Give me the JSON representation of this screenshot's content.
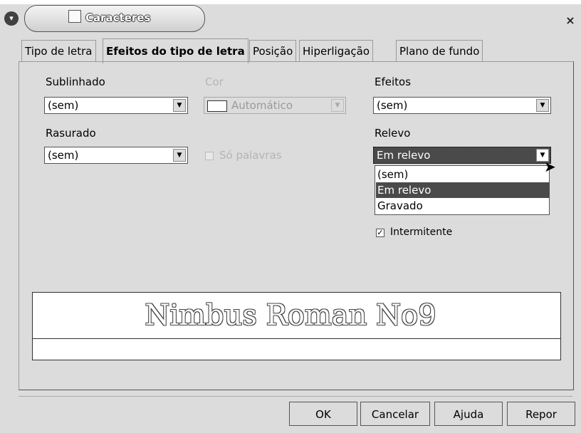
{
  "window": {
    "title": "Caracteres",
    "close_glyph": "×",
    "menu_glyph": "▾",
    "icon": "document-icon"
  },
  "tabs": [
    {
      "label": "Tipo de letra",
      "active": false
    },
    {
      "label": "Efeitos do tipo de letra",
      "active": true
    },
    {
      "label": "Posição",
      "active": false
    },
    {
      "label": "Hiperligação",
      "active": false
    },
    {
      "label": "Plano de fundo",
      "active": false
    }
  ],
  "fields": {
    "sublinhado": {
      "label": "Sublinhado",
      "value": "(sem)"
    },
    "cor": {
      "label": "Cor",
      "value": "Automático",
      "disabled": true
    },
    "efeitos": {
      "label": "Efeitos",
      "value": "(sem)"
    },
    "rasurado": {
      "label": "Rasurado",
      "value": "(sem)"
    },
    "so_palavras": {
      "label": "Só palavras",
      "checked": false,
      "disabled": true
    },
    "relevo": {
      "label": "Relevo",
      "value": "Em relevo",
      "open": true,
      "options": [
        "(sem)",
        "Em relevo",
        "Gravado"
      ],
      "selected_index": 1
    },
    "intermitente": {
      "label": "Intermitente",
      "checked": true
    }
  },
  "preview": {
    "text": "Nimbus Roman No9"
  },
  "buttons": {
    "ok": "OK",
    "cancelar": "Cancelar",
    "ajuda": "Ajuda",
    "repor": "Repor"
  }
}
